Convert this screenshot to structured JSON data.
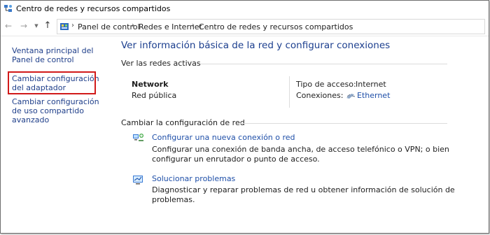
{
  "window": {
    "title": "Centro de redes y recursos compartidos"
  },
  "address": {
    "crumbs": [
      "Panel de control",
      "Redes e Internet",
      "Centro de redes y recursos compartidos"
    ]
  },
  "sidebar": {
    "items": [
      {
        "label": "Ventana principal del Panel de control"
      },
      {
        "label": "Cambiar configuración del adaptador"
      },
      {
        "label": "Cambiar configuración de uso compartido avanzado"
      }
    ]
  },
  "main": {
    "title": "Ver información básica de la red y configurar conexiones",
    "active_networks_label": "Ver las redes activas",
    "network": {
      "name": "Network",
      "profile": "Red pública",
      "access_type_label": "Tipo de acceso:",
      "access_type_value": "Internet",
      "connections_label": "Conexiones:",
      "connections_value": "Ethernet"
    },
    "change_settings_label": "Cambiar la configuración de red",
    "tasks": [
      {
        "label": "Configurar una nueva conexión o red",
        "description": "Configurar una conexión de banda ancha, de acceso telefónico o VPN; o bien configurar un enrutador o punto de acceso."
      },
      {
        "label": "Solucionar problemas",
        "description": "Diagnosticar y reparar problemas de red u obtener información de solución de problemas."
      }
    ]
  },
  "colors": {
    "link": "#1f4fa8",
    "title": "#1b3e8e",
    "highlight": "#d11a1a"
  }
}
